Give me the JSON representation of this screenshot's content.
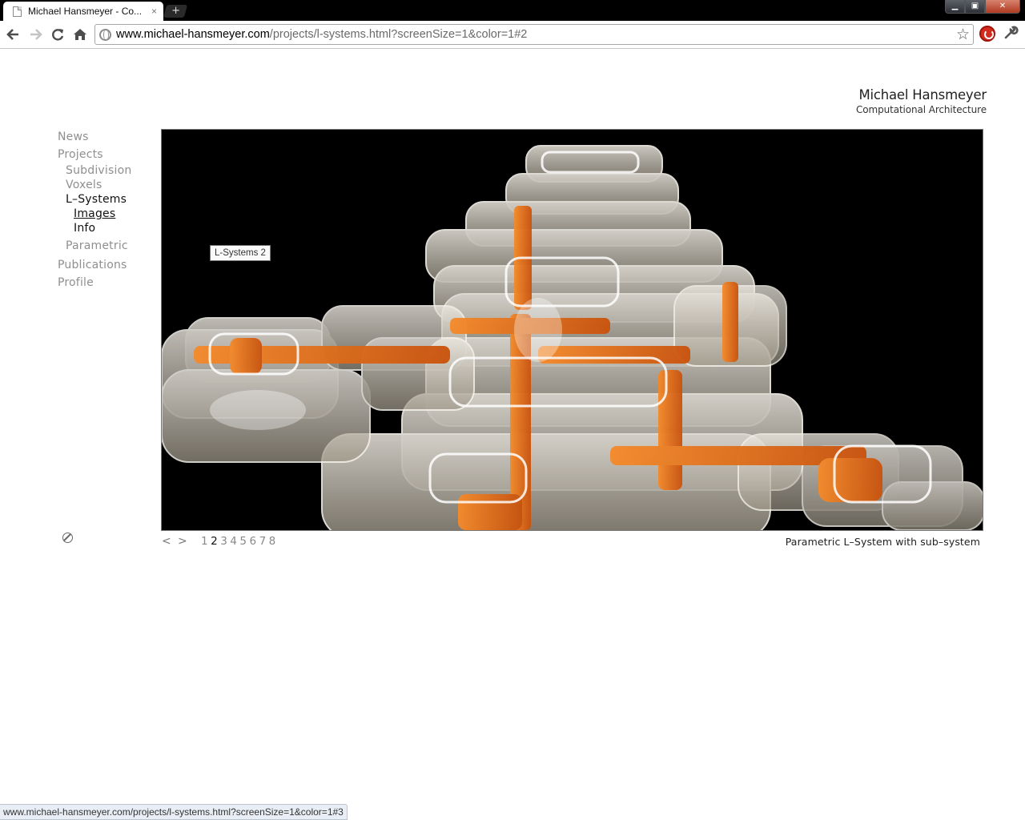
{
  "browser": {
    "tab_title": "Michael Hansmeyer - Co...",
    "tab_close": "×",
    "new_tab": "+",
    "window_controls": {
      "minimize": "▁",
      "maximize": "▣",
      "close": "✕"
    },
    "url_host": "www.michael-hansmeyer.com",
    "url_path": "/projects/l-systems.html?screenSize=1&color=1#2",
    "status_url": "www.michael-hansmeyer.com/projects/l-systems.html?screenSize=1&color=1#3"
  },
  "header": {
    "title": "Michael Hansmeyer",
    "subtitle": "Computational Architecture"
  },
  "menu": {
    "news": "News",
    "projects": "Projects",
    "subdivision": "Subdivision",
    "voxels": "Voxels",
    "lsystems": "L–Systems",
    "images": "Images",
    "info": "Info",
    "parametric": "Parametric",
    "publications": "Publications",
    "profile": "Profile"
  },
  "viewer": {
    "tooltip": "L-Systems 2",
    "colors": {
      "background": "#000000",
      "accent": "#f07a1c",
      "shell": "#d9d4c8"
    }
  },
  "pager": {
    "prev": "<",
    "next": ">",
    "pages": [
      "1",
      "2",
      "3",
      "4",
      "5",
      "6",
      "7",
      "8"
    ],
    "selected": "2"
  },
  "caption": "Parametric L–System with sub–system",
  "icons": {
    "back": "arrow-left-icon",
    "forward": "arrow-right-icon",
    "reload": "reload-icon",
    "home": "home-icon",
    "bookmark": "star-icon",
    "extension": "power-icon",
    "settings": "wrench-icon",
    "display": "settings-icon"
  }
}
